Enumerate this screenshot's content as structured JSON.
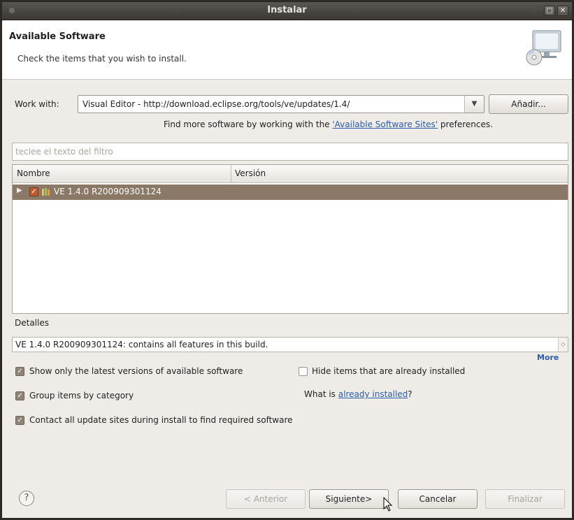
{
  "window": {
    "title": "Instalar"
  },
  "header": {
    "title": "Available Software",
    "description": "Check the items that you wish to install."
  },
  "work_with": {
    "label": "Work with:",
    "value": "Visual Editor - http://download.eclipse.org/tools/ve/updates/1.4/",
    "add_button": "Añadir..."
  },
  "find_more": {
    "prefix": "Find more software by working with the ",
    "link": "'Available Software Sites'",
    "suffix": " preferences."
  },
  "filter": {
    "placeholder": "teclee el texto del filtro"
  },
  "table": {
    "columns": [
      "Nombre",
      "Versión"
    ],
    "rows": [
      {
        "name": "VE 1.4.0 R200909301124",
        "version": "",
        "checked": true,
        "selected": true
      }
    ]
  },
  "details": {
    "label": "Detalles",
    "text": "VE 1.4.0 R200909301124: contains all features in this build.",
    "more": "More"
  },
  "options": {
    "latest_only": {
      "label": "Show only the latest versions of available software",
      "checked": true
    },
    "hide_installed": {
      "label": "Hide items that are already installed",
      "checked": false
    },
    "group_by_category": {
      "label": "Group items by category",
      "checked": true
    },
    "what_is_prefix": "What is ",
    "what_is_link": "already installed",
    "what_is_suffix": "?",
    "contact_all": {
      "label": "Contact all update sites during install to find required software",
      "checked": true
    }
  },
  "buttons": {
    "help": "?",
    "back": "< Anterior",
    "next": "Siguiente>",
    "cancel": "Cancelar",
    "finish": "Finalizar"
  },
  "colors": {
    "selection": "#8b7866",
    "checkbox_accent": "#c55a2a",
    "link": "#2a5db0"
  }
}
